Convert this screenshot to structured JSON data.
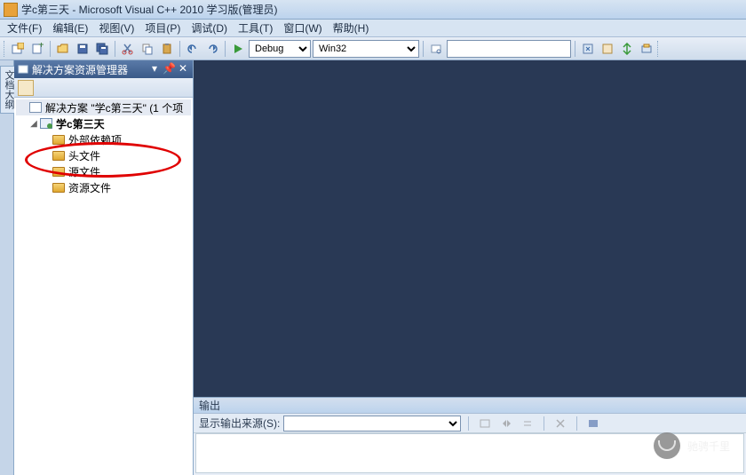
{
  "title": "学c第三天 - Microsoft Visual C++ 2010 学习版(管理员)",
  "menu": [
    "文件(F)",
    "编辑(E)",
    "视图(V)",
    "项目(P)",
    "调试(D)",
    "工具(T)",
    "窗口(W)",
    "帮助(H)"
  ],
  "toolbar": {
    "config": "Debug",
    "platform": "Win32",
    "search": ""
  },
  "panel": {
    "title": "解决方案资源管理器",
    "solution": "解决方案 \"学c第三天\" (1 个项",
    "project": "学c第三天",
    "nodes": [
      "外部依赖项",
      "头文件",
      "源文件",
      "资源文件"
    ]
  },
  "left_tab": "文档大纲",
  "output": {
    "title": "输出",
    "source_label": "显示输出来源(S):",
    "source_value": ""
  },
  "watermark": "驰骋千里"
}
